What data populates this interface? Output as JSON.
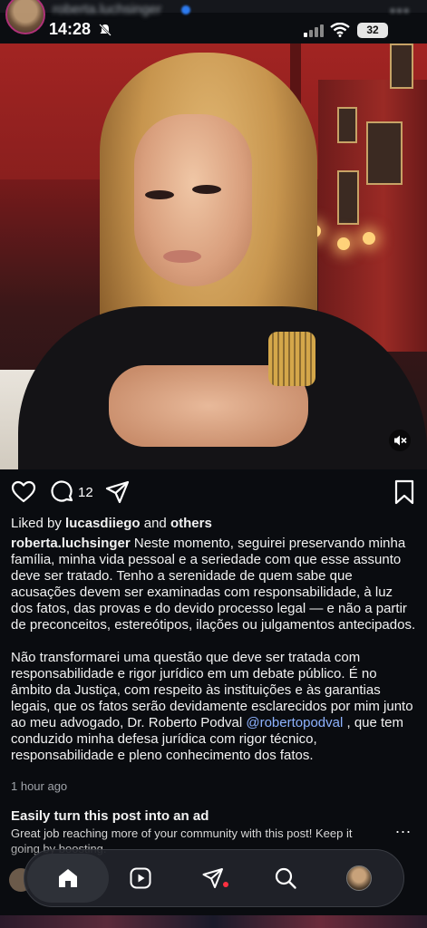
{
  "status_bar": {
    "time": "14:28",
    "battery": "32",
    "top_username": "roberta.luchsinger"
  },
  "post": {
    "comment_count": "12",
    "liked_prefix": "Liked by ",
    "liked_user": "lucasdiiego",
    "liked_and": " and ",
    "liked_others": "others",
    "author": "roberta.luchsinger",
    "caption_p1": " Neste momento, seguirei preservando minha família, minha vida pessoal e a seriedade com que esse assunto deve ser tratado. Tenho a serenidade de quem sabe que acusações devem ser examinadas com responsabilidade, à luz dos fatos, das provas e do devido processo legal — e não a partir de preconceitos, estereótipos, ilações ou julgamentos antecipados.",
    "caption_p2_start": "Não transformarei uma questão que deve ser tratada com responsabilidade e rigor jurídico em um debate público. É no âmbito da Justiça, com respeito às instituições e às garantias legais, que os fatos serão devidamente esclarecidos por mim junto ao meu advogado, Dr. Roberto Podval ",
    "mention": "@robertopodval",
    "caption_p2_end": " , que tem conduzido minha defesa jurídica com rigor técnico, responsabilidade e pleno conhecimento dos fatos.",
    "time_ago": "1 hour ago"
  },
  "promo": {
    "title": "Easily turn this post into an ad",
    "body": "Great job reaching more of your community with this post! Keep it going by boosting.",
    "more": "..."
  },
  "icons": {
    "like": "heart-icon",
    "comment": "comment-icon",
    "share": "send-icon",
    "save": "bookmark-icon",
    "mute": "muted-speaker-icon",
    "nav": [
      "home-icon",
      "reels-icon",
      "direct-icon",
      "search-icon",
      "profile-avatar"
    ]
  },
  "colors": {
    "background": "#0a0c10",
    "mention": "#8db2ff",
    "notification_dot": "#ff3040"
  }
}
